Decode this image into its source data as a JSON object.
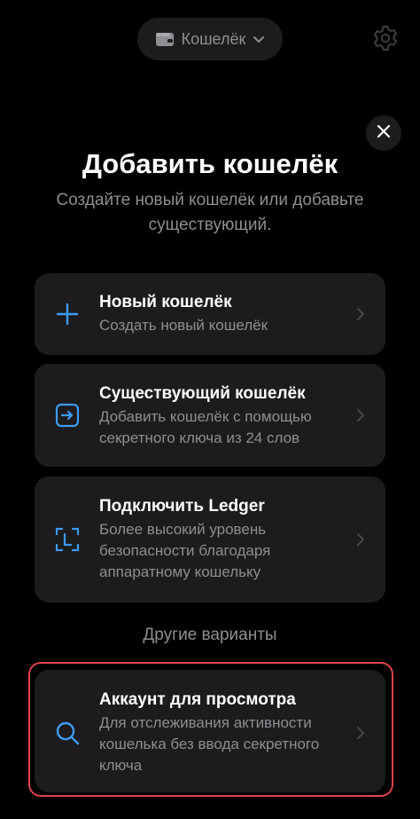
{
  "header": {
    "wallet_label": "Кошелёк",
    "icons": {
      "wallet": "wallet-icon",
      "dropdown": "chevron-down-icon",
      "settings": "gear-icon",
      "close": "close-icon"
    }
  },
  "title": "Добавить кошелёк",
  "subtitle": "Создайте новый кошелёк или добавьте существующий.",
  "options": [
    {
      "title": "Новый кошелёк",
      "description": "Создать новый кошелёк",
      "icon": "plus-icon"
    },
    {
      "title": "Существующий кошелёк",
      "description": "Добавить кошелёк с помощью секретного ключа из 24 слов",
      "icon": "import-icon"
    },
    {
      "title": "Подключить Ledger",
      "description": "Более высокий уровень безопасности благодаря аппаратному кошельку",
      "icon": "ledger-icon"
    }
  ],
  "other_label": "Другие варианты",
  "other_options": [
    {
      "title": "Аккаунт для просмотра",
      "description": "Для отслеживания активности кошелька без ввода секретного ключа",
      "icon": "search-icon"
    }
  ],
  "colors": {
    "background": "#000000",
    "card": "#1c1c1e",
    "accent": "#3d9bf0",
    "muted": "#8e8e93",
    "highlight": "#e0434b"
  }
}
